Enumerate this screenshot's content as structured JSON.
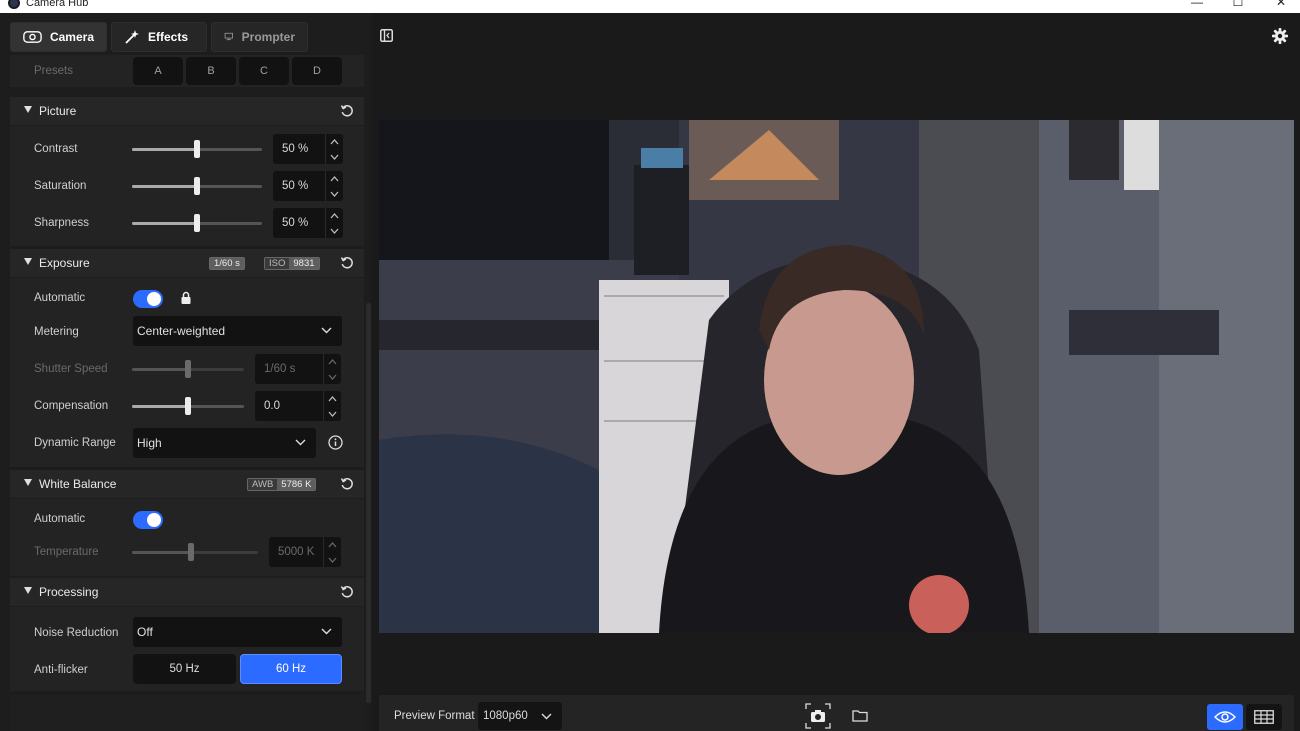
{
  "window": {
    "title": "Camera Hub",
    "controls": [
      "—",
      "☐",
      "✕"
    ]
  },
  "tabs": [
    {
      "label": "Camera",
      "icon": "camera-icon",
      "active": true
    },
    {
      "label": "Effects",
      "icon": "magic-wand-icon",
      "active": false
    },
    {
      "label": "Prompter",
      "icon": "prompter-icon",
      "active": false
    }
  ],
  "presets": {
    "label": "Presets",
    "buttons": [
      "A",
      "B",
      "C",
      "D"
    ]
  },
  "picture": {
    "title": "Picture",
    "rows": [
      {
        "label": "Contrast",
        "value": "50 %",
        "level": 0.5
      },
      {
        "label": "Saturation",
        "value": "50 %",
        "level": 0.5
      },
      {
        "label": "Sharpness",
        "value": "50 %",
        "level": 0.5
      }
    ]
  },
  "exposure": {
    "title": "Exposure",
    "badge_shutter": "1/60 s",
    "badge_iso_key": "ISO",
    "badge_iso_value": "9831",
    "automatic_label": "Automatic",
    "automatic_on": true,
    "metering_label": "Metering",
    "metering_value": "Center-weighted",
    "shutter_label": "Shutter Speed",
    "shutter_value": "1/60 s",
    "shutter_level": 0.5,
    "compensation_label": "Compensation",
    "compensation_value": "0.0",
    "compensation_level": 0.5,
    "dynamic_range_label": "Dynamic Range",
    "dynamic_range_value": "High"
  },
  "white_balance": {
    "title": "White Balance",
    "badge_key": "AWB",
    "badge_value": "5786 K",
    "automatic_label": "Automatic",
    "automatic_on": true,
    "temperature_label": "Temperature",
    "temperature_value": "5000 K",
    "temperature_level": 0.47
  },
  "processing": {
    "title": "Processing",
    "noise_label": "Noise Reduction",
    "noise_value": "Off",
    "antiflicker_label": "Anti-flicker",
    "antiflicker_options": [
      "50 Hz",
      "60 Hz"
    ],
    "antiflicker_selected": "60 Hz"
  },
  "preview": {
    "format_label": "Preview Format",
    "format_value": "1080p60"
  },
  "colors": {
    "accent": "#2b6bff",
    "panel": "#232323",
    "header": "#262626"
  }
}
